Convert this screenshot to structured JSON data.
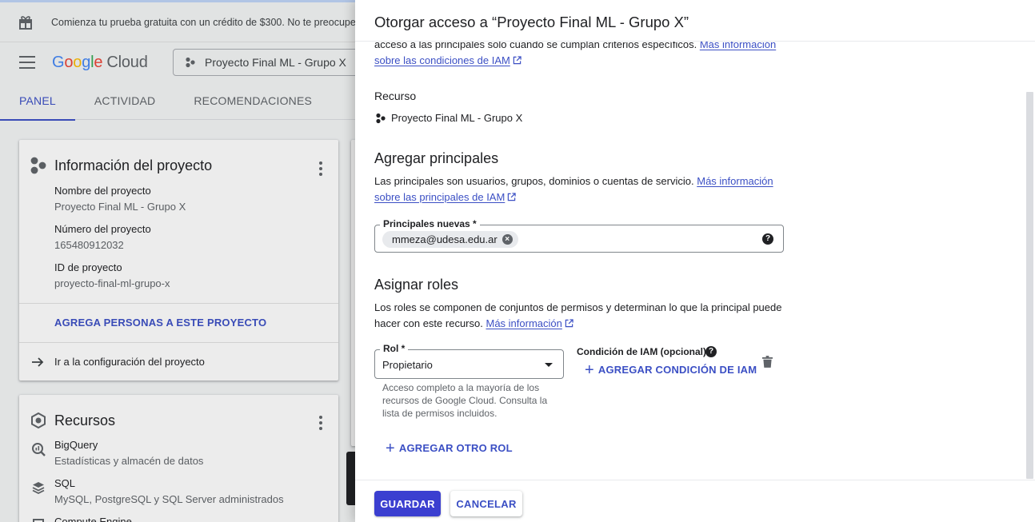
{
  "notice": {
    "text": "Comienza tu prueba gratuita con un crédito de $300. No te preocupes, no te cobraremos"
  },
  "header": {
    "logo_parts": [
      "G",
      "o",
      "o",
      "g",
      "l",
      "e"
    ],
    "logo_cloud": "Cloud",
    "project_picker": "Proyecto Final ML - Grupo X"
  },
  "tabs": [
    {
      "label": "PANEL",
      "active": true
    },
    {
      "label": "ACTIVIDAD",
      "active": false
    },
    {
      "label": "RECOMENDACIONES",
      "active": false
    }
  ],
  "project_info": {
    "title": "Información del proyecto",
    "fields": [
      {
        "label": "Nombre del proyecto",
        "value": "Proyecto Final ML - Grupo X"
      },
      {
        "label": "Número del proyecto",
        "value": "165480912032"
      },
      {
        "label": "ID de proyecto",
        "value": "proyecto-final-ml-grupo-x"
      }
    ],
    "add_people": "AGREGA PERSONAS A ESTE PROYECTO",
    "settings_link": "Ir a la configuración del proyecto"
  },
  "resources": {
    "title": "Recursos",
    "items": [
      {
        "name": "BigQuery",
        "desc": "Estadísticas y almacén de datos"
      },
      {
        "name": "SQL",
        "desc": "MySQL, PostgreSQL y SQL Server administrados"
      },
      {
        "name": "Compute Engine",
        "desc": ""
      }
    ]
  },
  "panel": {
    "title": "Otorgar acceso a “Proyecto Final ML - Grupo X”",
    "intro_text": "acceso a las principales solo cuando se cumplan criterios específicos.",
    "intro_link_1": "Más información",
    "intro_link_2": "sobre las condiciones de IAM",
    "resource_heading": "Recurso",
    "resource_name": "Proyecto Final ML - Grupo X",
    "add_principals": {
      "heading": "Agregar principales",
      "text": "Las principales son usuarios, grupos, dominios o cuentas de servicio.",
      "link_1": "Más información",
      "link_2": "sobre las principales de IAM",
      "field_label": "Principales nuevas *",
      "chip": "mmeza@udesa.edu.ar"
    },
    "assign_roles": {
      "heading": "Asignar roles",
      "text_1": "Los roles se componen de conjuntos de permisos y determinan lo que la principal puede",
      "text_2": "hacer con este recurso.",
      "link": "Más información",
      "role_label": "Rol *",
      "role_value": "Propietario",
      "role_help": "Acceso completo a la mayoría de los recursos de Google Cloud. Consulta la lista de permisos incluidos.",
      "condition_label": "Condición de IAM (opcional)",
      "add_condition": "AGREGAR CONDICIÓN DE IAM",
      "add_role": "AGREGAR OTRO ROL"
    },
    "save": "GUARDAR",
    "cancel": "CANCELAR"
  },
  "colors": {
    "accent": "#3b4fc4",
    "primary_button": "#3b3fd0"
  }
}
